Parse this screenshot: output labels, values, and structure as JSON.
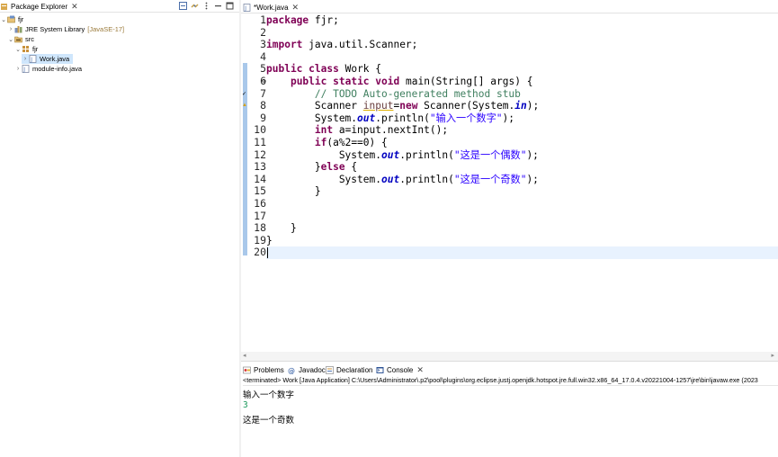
{
  "package_explorer": {
    "tab_label": "Package Explorer",
    "tree": [
      {
        "label": "fjr",
        "decoration": ""
      },
      {
        "label": "JRE System Library",
        "decoration": "[JavaSE-17]"
      },
      {
        "label": "src",
        "decoration": ""
      },
      {
        "label": "fjr",
        "decoration": ""
      },
      {
        "label": "Work.java",
        "decoration": ""
      },
      {
        "label": "module-info.java",
        "decoration": ""
      }
    ]
  },
  "editor": {
    "tab_label": "*Work.java",
    "line_numbers": [
      "1",
      "2",
      "3",
      "4",
      "5",
      "6",
      "7",
      "8",
      "9",
      "10",
      "11",
      "12",
      "13",
      "14",
      "15",
      "16",
      "17",
      "18",
      "19",
      "20"
    ],
    "current_line": 20
  },
  "bottom": {
    "tabs": [
      {
        "label": "Problems"
      },
      {
        "label": "Javadoc"
      },
      {
        "label": "Declaration"
      },
      {
        "label": "Console"
      }
    ],
    "console_description": "<terminated> Work [Java Application] C:\\Users\\Administrator\\.p2\\pool\\plugins\\org.eclipse.justj.openjdk.hotspot.jre.full.win32.x86_64_17.0.4.v20221004-1257\\jre\\bin\\javaw.exe  (2023",
    "output": [
      {
        "text": "输入一个数字",
        "kind": "stdout"
      },
      {
        "text": "3",
        "kind": "stdin"
      },
      {
        "text": "这是一个奇数",
        "kind": "stdout"
      }
    ]
  },
  "colors": {
    "keyword": "#7f0055",
    "comment": "#3f7f5f",
    "string": "#2a00ff",
    "field": "#0000c0",
    "console_input": "#1d9a5d",
    "current_line_highlight": "#e8f2fe"
  }
}
